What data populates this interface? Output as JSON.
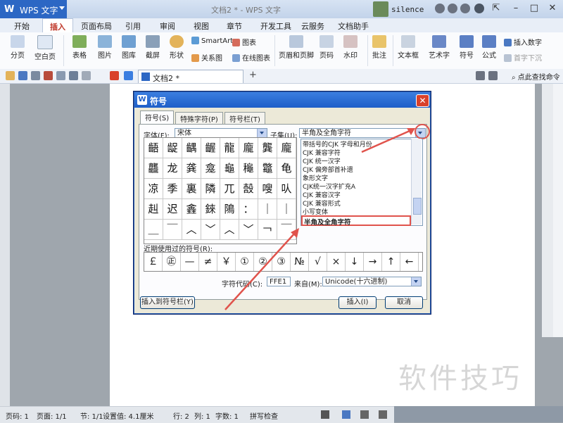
{
  "app": {
    "name": "WPS 文字",
    "logo": "W",
    "window_title": "文档2 * - WPS 文字",
    "username": "silence"
  },
  "ribbon_tabs": [
    "开始",
    "插入",
    "页面布局",
    "引用",
    "审阅",
    "视图",
    "章节",
    "开发工具",
    "云服务",
    "文档助手"
  ],
  "active_tab": "插入",
  "ribbon": {
    "groups": [
      {
        "label": "分页",
        "icon": "page-break-icon"
      },
      {
        "label": "空白页",
        "icon": "blank-page-icon"
      },
      {
        "label": "表格",
        "icon": "table-icon"
      },
      {
        "label": "图片",
        "icon": "picture-icon"
      },
      {
        "label": "图库",
        "icon": "gallery-icon"
      },
      {
        "label": "截屏",
        "icon": "screenshot-icon"
      },
      {
        "label": "形状",
        "icon": "shapes-icon"
      },
      {
        "label": "页眉和页脚",
        "icon": "header-footer-icon"
      },
      {
        "label": "页码",
        "icon": "page-number-icon"
      },
      {
        "label": "水印",
        "icon": "watermark-icon"
      },
      {
        "label": "批注",
        "icon": "comment-icon"
      },
      {
        "label": "文本框",
        "icon": "textbox-icon"
      },
      {
        "label": "艺术字",
        "icon": "wordart-icon"
      },
      {
        "label": "符号",
        "icon": "symbol-icon"
      },
      {
        "label": "公式",
        "icon": "formula-icon"
      }
    ],
    "small": {
      "smartart": "SmartArt",
      "chart": "图表",
      "relation": "关系图",
      "online_chart": "在线图表",
      "insert_number": "插入数字",
      "drop_cap": "首字下沉"
    }
  },
  "doc_tab": "文档2 *",
  "help_search": "点此查找命令",
  "dialog": {
    "title": "符号",
    "tabs": [
      "符号(S)",
      "特殊字符(P)",
      "符号栏(T)"
    ],
    "font_label": "字体(F):",
    "font_value": "宋体",
    "subset_label": "子集(U):",
    "subset_value": "半角及全角字符",
    "grid_chars": [
      "齬",
      "龊",
      "齵",
      "齷",
      "龍",
      "龐",
      "龔",
      "龐",
      "龑",
      "龘",
      "龙",
      "龚",
      "龛",
      "龜",
      "龝",
      "龞",
      "龟",
      "龠",
      "凉",
      "季",
      "裏",
      "隣",
      "兀",
      "嗀",
      "嗖",
      "㕥",
      "崎",
      "赳",
      "迟",
      "錱",
      "錸",
      "隝",
      "：",
      "｜",
      "｜",
      "｜",
      "＿",
      "￣",
      "︿",
      "﹀",
      "︿",
      "﹀",
      "￢",
      "￣",
      "￣"
    ],
    "subset_list": [
      "带括号的CJK 字母和月份",
      "CJK 兼容字符",
      "CJK 统一汉字",
      "CJK 偏旁部首补遗",
      "象形文字",
      "CJK统一汉字扩充A",
      "CJK 兼容汉字",
      "CJK 兼容形式",
      "小写变体",
      "半角及全角字符"
    ],
    "recent_label": "近期使用过的符号(R):",
    "recent": [
      "￡",
      "㊣",
      "—",
      "≠",
      "￥",
      "①",
      "②",
      "③",
      "№",
      "√",
      "×",
      "↓",
      "→",
      "↑",
      "←"
    ],
    "charcode_label": "字符代码(C):",
    "charcode_value": "FFE1",
    "from_label": "来自(M):",
    "from_value": "Unicode(十六进制)",
    "insert_to_bar": "插入到符号栏(Y)",
    "insert_btn": "插入(I)",
    "cancel_btn": "取消"
  },
  "status": {
    "page_num": "页码: 1",
    "pages": "页面: 1/1",
    "section": "节: 1/1",
    "setting": "设置值: 4.1厘米",
    "row": "行: 2",
    "col": "列: 1",
    "words": "字数: 1",
    "spellcheck": "拼写检查"
  },
  "watermark_text": "软件技巧",
  "colors": {
    "accent": "#2c67c4",
    "annotation": "#e0534c",
    "active_tab": "#c0392b"
  }
}
